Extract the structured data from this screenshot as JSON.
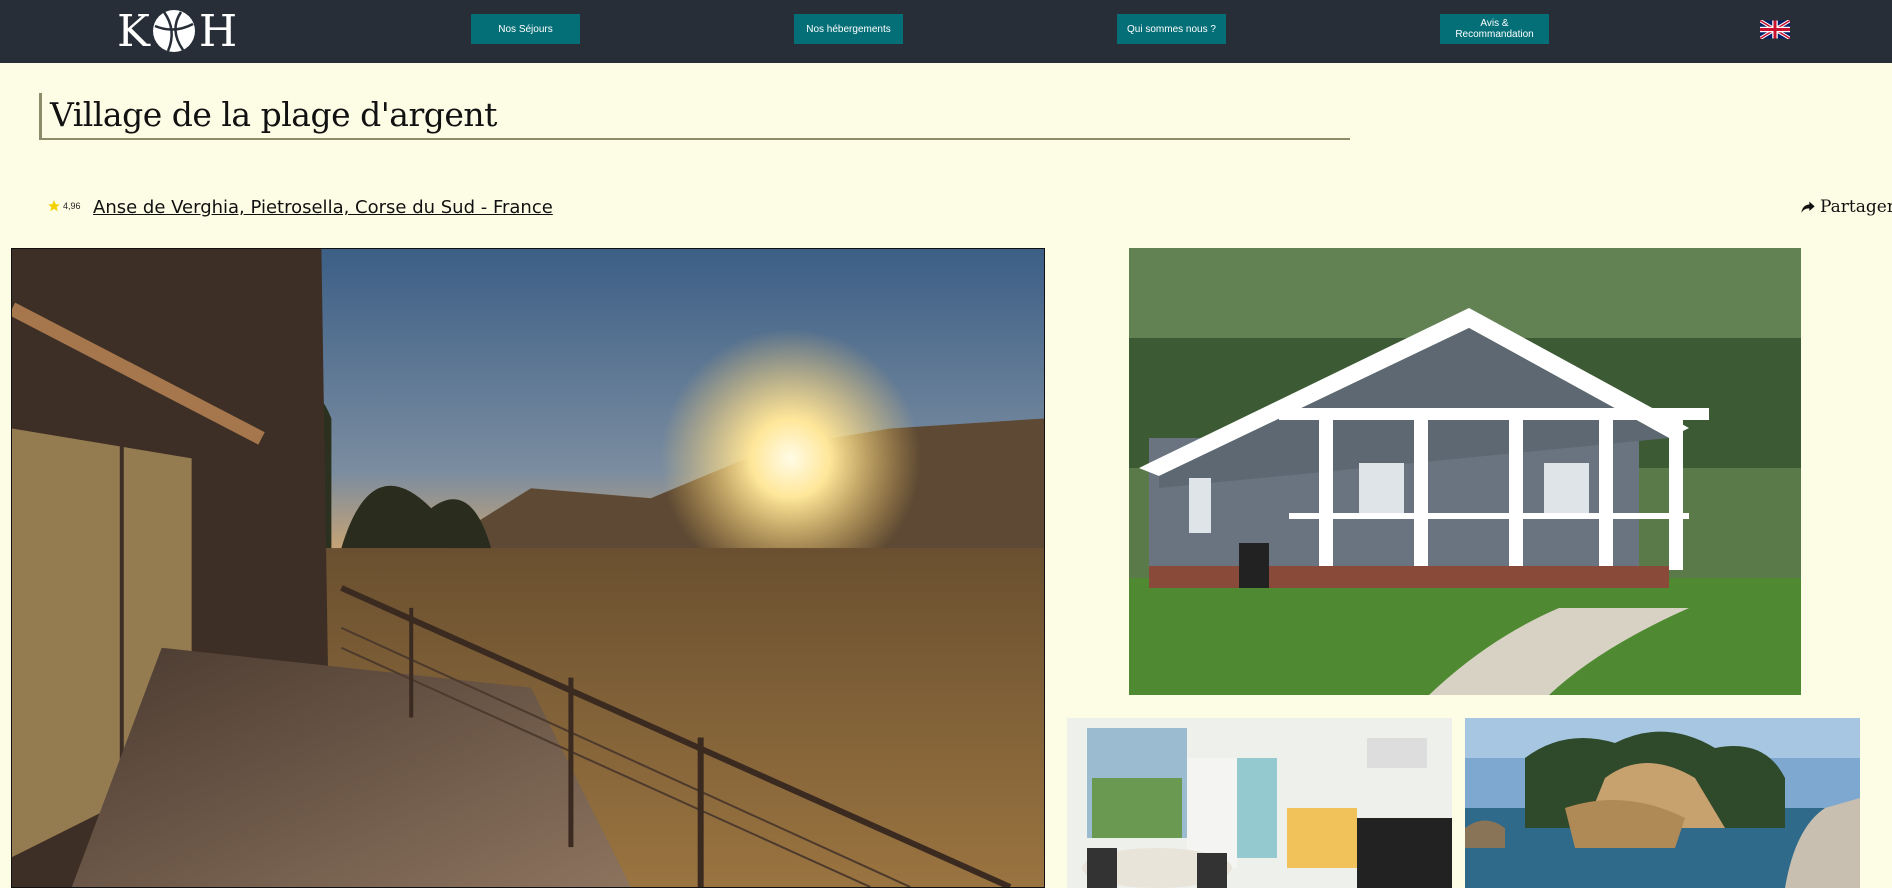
{
  "nav": {
    "logo_text_left": "K",
    "logo_text_right": "H",
    "items": [
      {
        "label": "Nos Séjours"
      },
      {
        "label": "Nos hébergements"
      },
      {
        "label": "Qui sommes nous ?"
      },
      {
        "label": "Avis & Recommandation"
      }
    ],
    "language_icon": "uk-flag-icon"
  },
  "listing": {
    "title": "Village de la plage d'argent",
    "rating": "4,96",
    "location": "Anse de Verghia, Pietrosella, Corse du Sud - France",
    "share_label": "Partager"
  },
  "colors": {
    "nav_bg": "#272e37",
    "nav_button": "#056f78",
    "page_bg": "#fdfde6",
    "accent_line": "#8c8c6a"
  },
  "photos": [
    {
      "name": "sunset-terrace-photo"
    },
    {
      "name": "house-porch-photo"
    },
    {
      "name": "interior-photo"
    },
    {
      "name": "rocky-coast-photo"
    }
  ]
}
